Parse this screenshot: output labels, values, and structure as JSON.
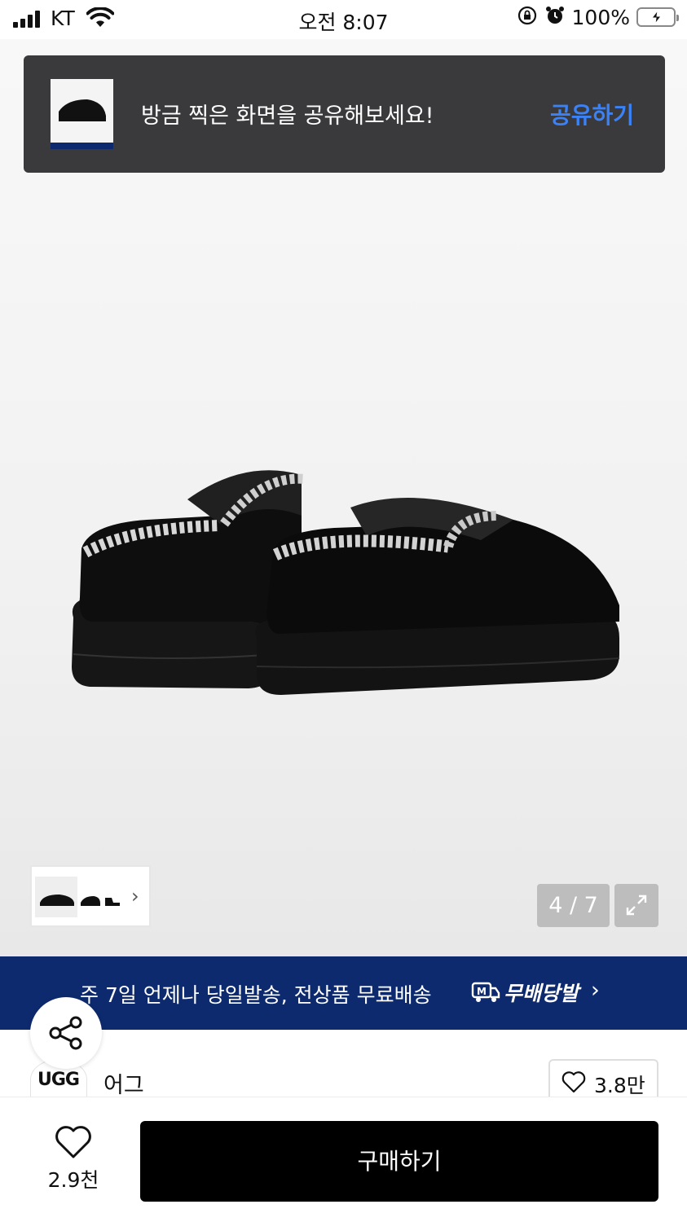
{
  "status_bar": {
    "carrier": "KT",
    "time": "오전 8:07",
    "battery_percent": "100%",
    "battery_level": 1.0,
    "icons": [
      "signal-icon",
      "wifi-icon",
      "orientation-lock-icon",
      "alarm-icon",
      "battery-charging-icon"
    ]
  },
  "toast": {
    "message": "방금 찍은 화면을 공유해보세요!",
    "action": "공유하기",
    "action_color": "#3b82f6"
  },
  "gallery": {
    "counter": "4 / 7",
    "icons": [
      "chevron-right-icon",
      "expand-icon"
    ]
  },
  "promo": {
    "text": "주 7일 언제나 당일발송, 전상품 무료배송",
    "brand": "무배당발",
    "background": "#0d2a6e"
  },
  "brand": {
    "logo_text": "UGG",
    "name": "어그",
    "like_count": "3.8만"
  },
  "bottom_bar": {
    "wish_count": "2.9천",
    "buy_label": "구매하기"
  }
}
